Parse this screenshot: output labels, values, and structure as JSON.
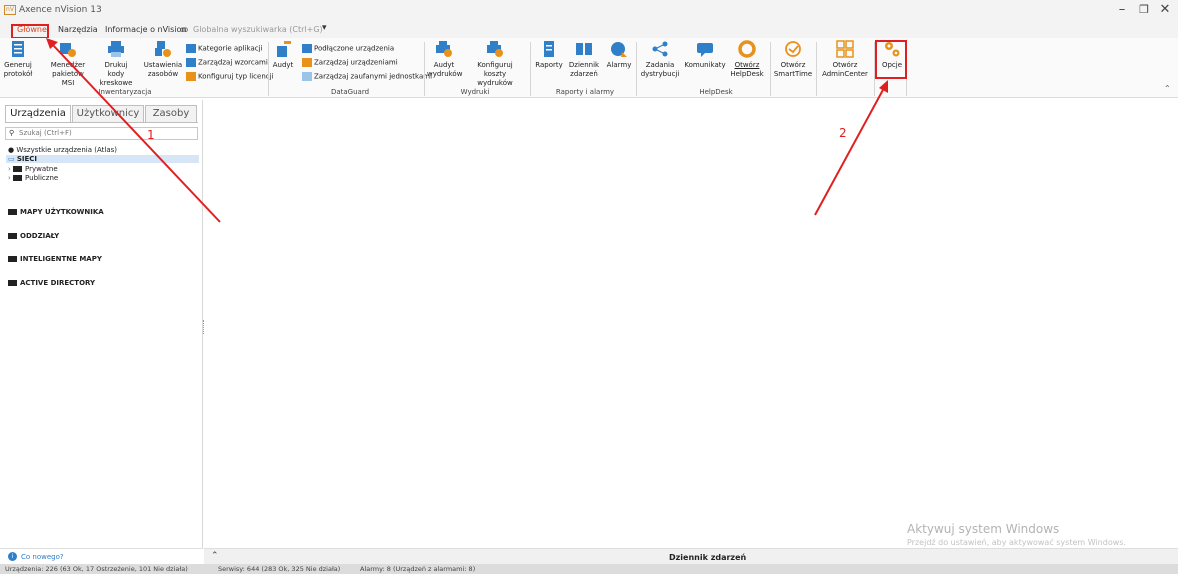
{
  "window": {
    "title": "Axence nVision 13",
    "icon_text": "nV"
  },
  "menu": {
    "items": [
      "Główne",
      "Narzędzia",
      "Informacje o nVision"
    ],
    "search_label": "Globalna wyszukiwarka (Ctrl+G)"
  },
  "ribbon": {
    "groups": {
      "inventory": "Inwentaryzacja",
      "dataguard": "DataGuard",
      "prints": "Wydruki",
      "reports": "Raporty i alarmy",
      "helpdesk": "HelpDesk"
    },
    "buttons": {
      "generate_protocol": [
        "Generuj",
        "protokół"
      ],
      "msi_manager": [
        "Menedżer",
        "pakietów MSI"
      ],
      "print_barcodes": [
        "Drukuj kody",
        "kreskowe"
      ],
      "resource_settings": [
        "Ustawienia",
        "zasobów"
      ],
      "app_categories": "Kategorie aplikacji",
      "manage_templates": "Zarządzaj wzorcami",
      "license_types": "Konfiguruj typ licencji",
      "audit": "Audyt",
      "connected_devices": "Podłączone urządzenia",
      "manage_devices": "Zarządzaj urządzeniami",
      "trusted_units": "Zarządzaj zaufanymi jednostkami",
      "print_audit": [
        "Audyt",
        "wydruków"
      ],
      "print_costs": [
        "Konfiguruj",
        "koszty wydruków"
      ],
      "reports": "Raporty",
      "event_log": [
        "Dziennik",
        "zdarzeń"
      ],
      "alarms": "Alarmy",
      "distribution_tasks": [
        "Zadania",
        "dystrybucji"
      ],
      "messages": "Komunikaty",
      "open_helpdesk": [
        "Otwórz",
        "HelpDesk"
      ],
      "open_smarttime": [
        "Otwórz",
        "SmartTime"
      ],
      "open_admincenter": [
        "Otwórz",
        "AdminCenter"
      ],
      "options": "Opcje"
    }
  },
  "panel": {
    "tabs": [
      "Urządzenia",
      "Użytkownicy",
      "Zasoby"
    ],
    "search_placeholder": "Szukaj (Ctrl+F)",
    "tree": {
      "all_devices": "Wszystkie urządzenia (Atlas)",
      "networks": "SIECI",
      "private": "Prywatne",
      "public": "Publiczne"
    },
    "sections": [
      "MAPY UŻYTKOWNIKA",
      "ODDZIAŁY",
      "INTELIGENTNE MAPY",
      "ACTIVE DIRECTORY"
    ],
    "whats_new": "Co nowego?"
  },
  "event_log_bar": {
    "title": "Dziennik zdarzeń",
    "toggle": "⌃"
  },
  "status": {
    "devices": "Urządzenia: 226 (63 Ok, 17 Ostrzeżenie, 101 Nie działa)",
    "services": "Serwisy: 644 (283 Ok, 325 Nie działa)",
    "alarms": "Alarmy: 8 (Urządzeń z alarmami: 8)"
  },
  "watermark": {
    "line1": "Aktywuj system Windows",
    "line2": "Przejdź do ustawień, aby aktywować system Windows."
  },
  "annotations": {
    "step1": "1",
    "step2": "2"
  },
  "colors": {
    "annotation": "#e02020",
    "ribbon_icon": "#2f7fc9",
    "ribbon_accent": "#e8921c"
  }
}
